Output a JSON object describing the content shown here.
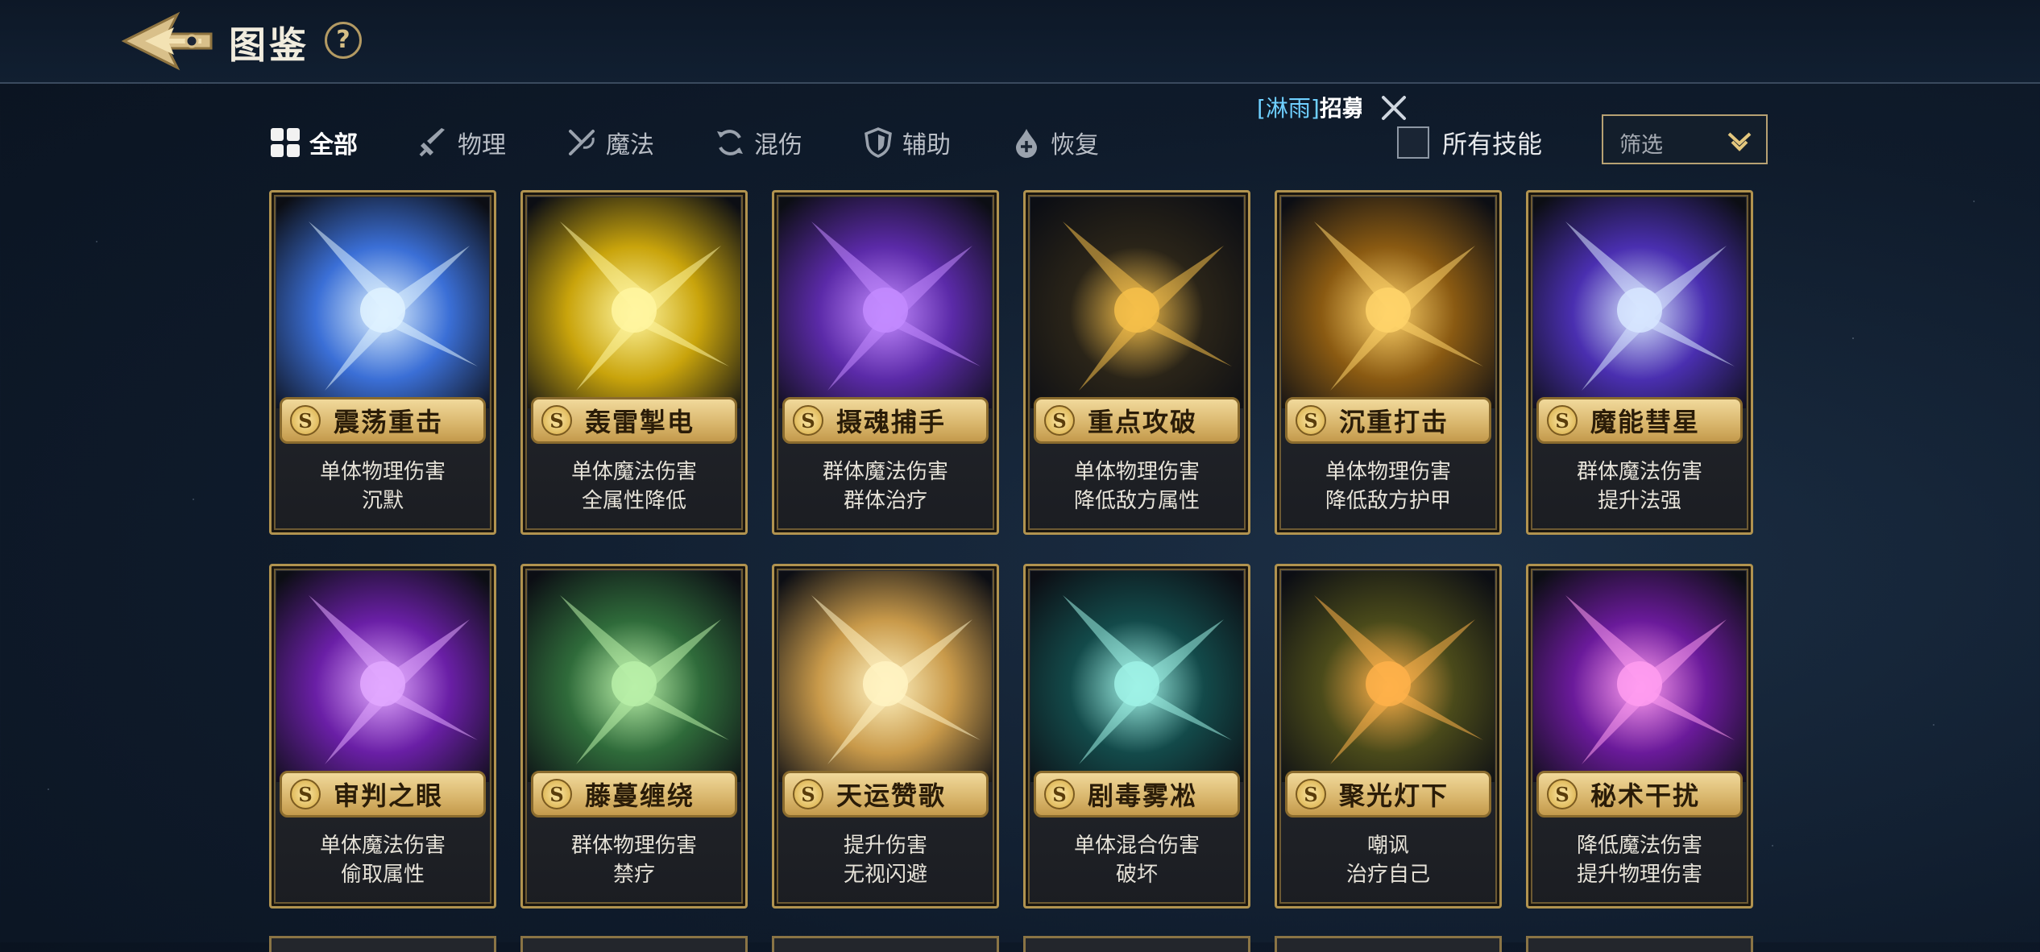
{
  "header": {
    "title": "图鉴",
    "help_label": "?"
  },
  "ticker": {
    "tag": "[淋雨]",
    "message": "招募"
  },
  "tabs": [
    {
      "label": "全部",
      "icon": "grid-icon",
      "active": true
    },
    {
      "label": "物理",
      "icon": "sword-icon",
      "active": false
    },
    {
      "label": "魔法",
      "icon": "magic-icon",
      "active": false
    },
    {
      "label": "混伤",
      "icon": "cycle-icon",
      "active": false
    },
    {
      "label": "辅助",
      "icon": "shield-icon",
      "active": false
    },
    {
      "label": "恢复",
      "icon": "droplet-icon",
      "active": false
    }
  ],
  "all_skills": {
    "label": "所有技能",
    "checked": false
  },
  "filter": {
    "placeholder": "筛选"
  },
  "cards": [
    {
      "rank": "S",
      "name": "震荡重击",
      "desc1": "单体物理伤害",
      "desc2": "沉默",
      "theme": "#3b6fd6",
      "accent": "#dff2ff"
    },
    {
      "rank": "S",
      "name": "轰雷掣电",
      "desc1": "单体魔法伤害",
      "desc2": "全属性降低",
      "theme": "#c9a40c",
      "accent": "#fff6a0"
    },
    {
      "rank": "S",
      "name": "摄魂捕手",
      "desc1": "群体魔法伤害",
      "desc2": "群体治疗",
      "theme": "#5b2aa8",
      "accent": "#c38bff"
    },
    {
      "rank": "S",
      "name": "重点攻破",
      "desc1": "单体物理伤害",
      "desc2": "降低敌方属性",
      "theme": "#2a2418",
      "accent": "#f6c04a"
    },
    {
      "rank": "S",
      "name": "沉重打击",
      "desc1": "单体物理伤害",
      "desc2": "降低敌方护甲",
      "theme": "#8a5a12",
      "accent": "#ffd36a"
    },
    {
      "rank": "S",
      "name": "魔能彗星",
      "desc1": "群体魔法伤害",
      "desc2": "提升法强",
      "theme": "#4a2fb0",
      "accent": "#d7e6ff"
    },
    {
      "rank": "S",
      "name": "审判之眼",
      "desc1": "单体魔法伤害",
      "desc2": "偷取属性",
      "theme": "#6a1fa6",
      "accent": "#e2a8ff"
    },
    {
      "rank": "S",
      "name": "藤蔓缠绕",
      "desc1": "群体物理伤害",
      "desc2": "禁疗",
      "theme": "#2f6b3a",
      "accent": "#b9f0a8"
    },
    {
      "rank": "S",
      "name": "天运赞歌",
      "desc1": "提升伤害",
      "desc2": "无视闪避",
      "theme": "#c99a4a",
      "accent": "#fff3c2"
    },
    {
      "rank": "S",
      "name": "剧毒雾凇",
      "desc1": "单体混合伤害",
      "desc2": "破坏",
      "theme": "#134a4a",
      "accent": "#9ff2e6"
    },
    {
      "rank": "S",
      "name": "聚光灯下",
      "desc1": "嘲讽",
      "desc2": "治疗自己",
      "theme": "#4a4a1a",
      "accent": "#ffb24a"
    },
    {
      "rank": "S",
      "name": "秘术干扰",
      "desc1": "降低魔法伤害",
      "desc2": "提升物理伤害",
      "theme": "#6a1a9a",
      "accent": "#ff9cf0"
    }
  ]
}
